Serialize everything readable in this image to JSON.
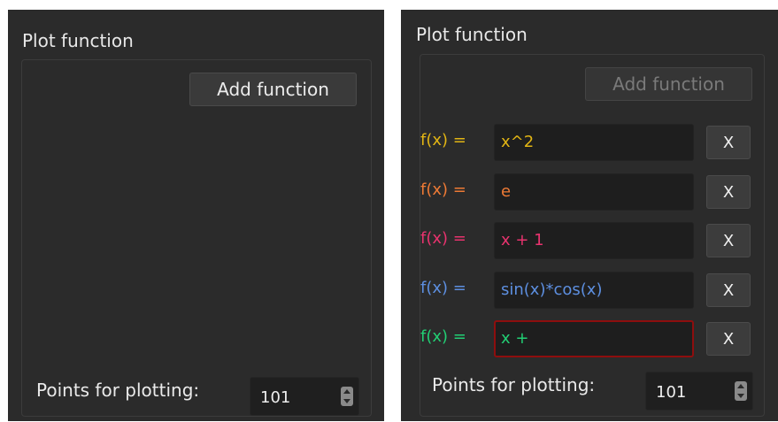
{
  "left_panel": {
    "title": "Plot function",
    "add_button_label": "Add function",
    "points_label": "Points for plotting:",
    "points_value": "101"
  },
  "right_panel": {
    "title": "Plot function",
    "add_button_label": "Add function",
    "points_label": "Points for plotting:",
    "points_value": "101",
    "functions": [
      {
        "label": "f(x) =",
        "value": "x^2",
        "color": "#e2b514",
        "remove_label": "X"
      },
      {
        "label": "f(x) =",
        "value": "e",
        "color": "#ee7a35",
        "remove_label": "X"
      },
      {
        "label": "f(x) =",
        "value": "x + 1",
        "color": "#e8336e",
        "remove_label": "X"
      },
      {
        "label": "f(x) =",
        "value": "sin(x)*cos(x)",
        "color": "#5d8fe0",
        "remove_label": "X"
      },
      {
        "label": "f(x) =",
        "value": "x +",
        "color": "#22cf74",
        "remove_label": "X"
      }
    ]
  }
}
